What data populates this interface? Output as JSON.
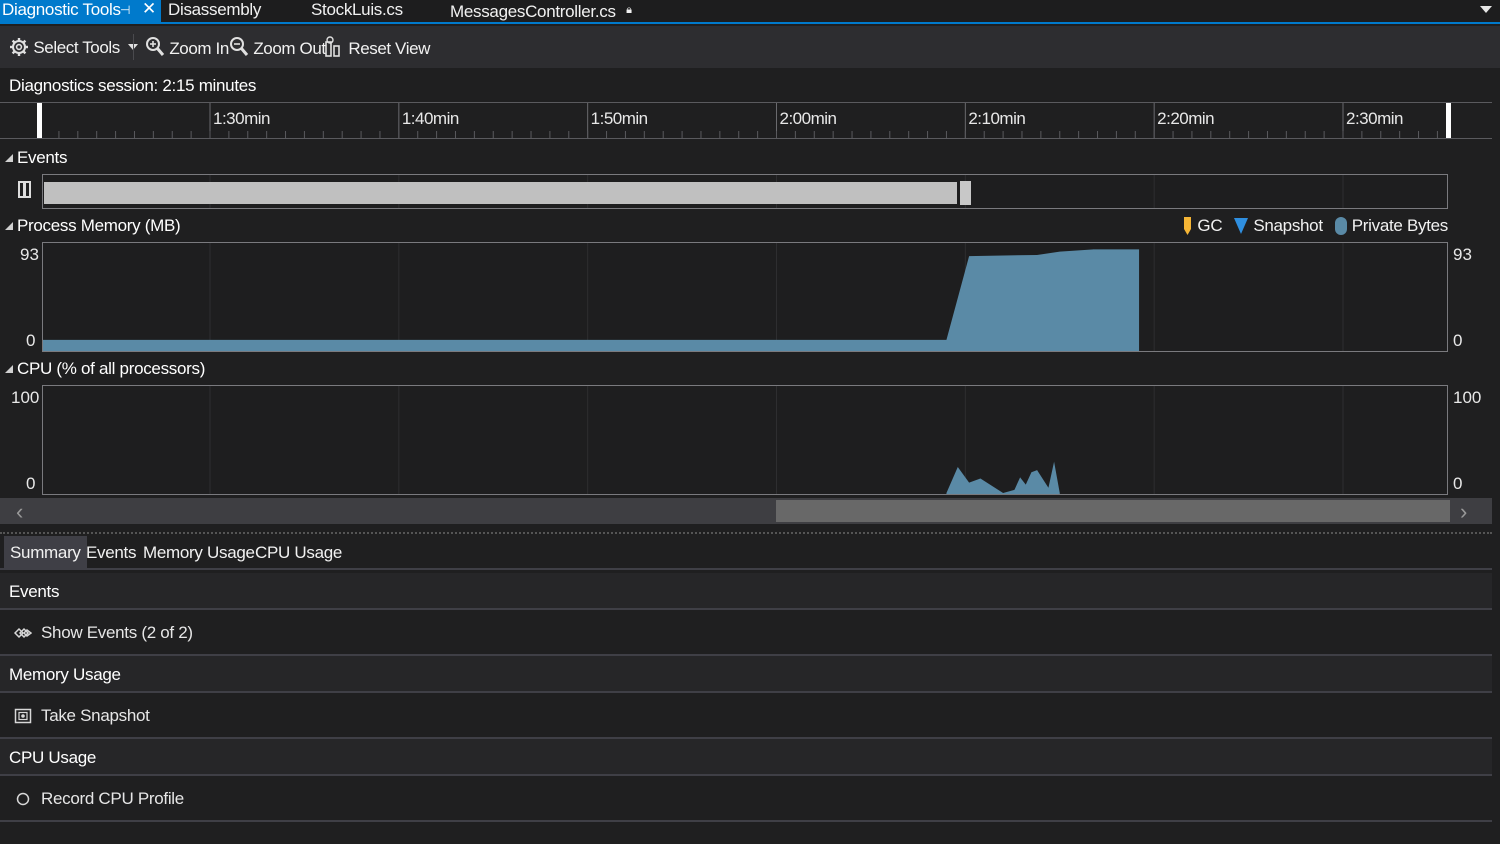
{
  "tabs": [
    {
      "label": "Diagnostic Tools",
      "active": true
    },
    {
      "label": "Disassembly"
    },
    {
      "label": "StockLuis.cs"
    },
    {
      "label": "MessagesController.cs"
    }
  ],
  "toolbar": {
    "select_tools": "Select Tools",
    "zoom_in": "Zoom In",
    "zoom_out": "Zoom Out",
    "reset_view": "Reset View"
  },
  "session_label": "Diagnostics session: 2:15 minutes",
  "ruler_ticks": [
    "1:30min",
    "1:40min",
    "1:50min",
    "2:00min",
    "2:10min",
    "2:20min",
    "2:30min"
  ],
  "sections": {
    "events": "Events",
    "memory": "Process Memory (MB)",
    "cpu": "CPU (% of all processors)"
  },
  "legend": {
    "gc": "GC",
    "snapshot": "Snapshot",
    "private_bytes": "Private Bytes"
  },
  "memory_axis": {
    "max": "93",
    "min": "0"
  },
  "cpu_axis": {
    "max": "100",
    "min": "0"
  },
  "colors": {
    "accent": "#007acc",
    "series_fill": "#5a8aa6",
    "gc": "#f5b535",
    "snapshot": "#2f8fe0",
    "private_bytes": "#5a8aa6"
  },
  "chart_data": [
    {
      "type": "area",
      "title": "Process Memory (MB)",
      "ylim": [
        0,
        93
      ],
      "x_unit": "min",
      "x": [
        1.2,
        2.1,
        2.15,
        2.17,
        2.23,
        2.25,
        2.28,
        2.32
      ],
      "values": [
        9,
        9,
        9,
        84,
        85,
        88,
        90,
        90
      ]
    },
    {
      "type": "area",
      "title": "CPU (% of all processors)",
      "ylim": [
        0,
        100
      ],
      "x_unit": "min",
      "x": [
        2.15,
        2.16,
        2.17,
        2.18,
        2.2,
        2.21,
        2.215,
        2.22,
        2.225,
        2.23,
        2.24,
        2.245,
        2.25
      ],
      "values": [
        0,
        25,
        10,
        14,
        0,
        3,
        15,
        8,
        20,
        22,
        5,
        30,
        0
      ]
    }
  ],
  "summary_tabs": [
    "Summary",
    "Events",
    "Memory Usage",
    "CPU Usage"
  ],
  "summary": {
    "events_head": "Events",
    "show_events": "Show Events (2 of 2)",
    "memory_head": "Memory Usage",
    "take_snapshot": "Take Snapshot",
    "cpu_head": "CPU Usage",
    "record_cpu": "Record CPU Profile"
  }
}
